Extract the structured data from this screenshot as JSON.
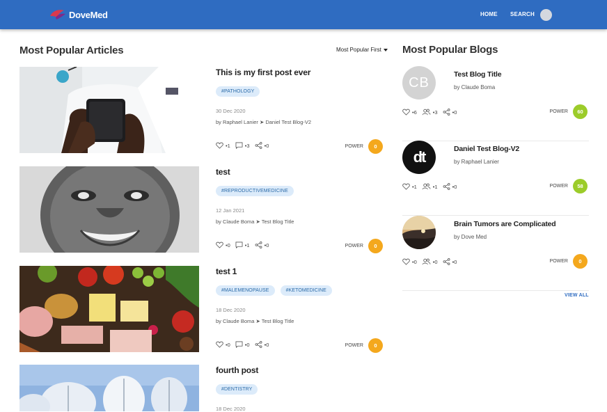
{
  "nav": {
    "logo": "DoveMed",
    "links": [
      "HOME",
      "SEARCH"
    ]
  },
  "articles_section": {
    "title": "Most Popular Articles",
    "sort_label": "Most Popular First",
    "items": [
      {
        "title": "This is my first post ever",
        "tags": [
          "#PATHOLOGY"
        ],
        "date": "30 Dec 2020",
        "byline": "by Raphael Lanier ➤ Daniel Test Blog-V2",
        "likes": "•1",
        "comments": "•3",
        "shares": "•0",
        "power_label": "POWER",
        "power": "0"
      },
      {
        "title": "test",
        "tags": [
          "#REPRODUCTIVEMEDICINE"
        ],
        "date": "12 Jan 2021",
        "byline": "by Claude Boma ➤ Test Blog Title",
        "likes": "•0",
        "comments": "•1",
        "shares": "•0",
        "power_label": "POWER",
        "power": "0"
      },
      {
        "title": "test 1",
        "tags": [
          "#MALEMENOPAUSE",
          "#KETOMEDICINE"
        ],
        "date": "18 Dec 2020",
        "byline": "by Claude Boma ➤ Test Blog Title",
        "likes": "•0",
        "comments": "•0",
        "shares": "•0",
        "power_label": "POWER",
        "power": "0"
      },
      {
        "title": "fourth post",
        "tags": [
          "#DENTISTRY"
        ],
        "date": "18 Dec 2020"
      }
    ]
  },
  "blogs_section": {
    "title": "Most Popular Blogs",
    "view_all": "VIEW ALL",
    "items": [
      {
        "avatar_text": "CB",
        "title": "Test Blog Title",
        "byline": "by Claude Boma",
        "likes": "•6",
        "followers": "•3",
        "shares": "•0",
        "power_label": "POWER",
        "power": "60"
      },
      {
        "avatar_text": "dt",
        "title": "Daniel Test Blog-V2",
        "byline": "by Raphael Lanier",
        "likes": "•1",
        "followers": "•1",
        "shares": "•0",
        "power_label": "POWER",
        "power": "58"
      },
      {
        "title": "Brain Tumors are Complicated",
        "byline": "by Dove Med",
        "likes": "•0",
        "followers": "•0",
        "shares": "•0",
        "power_label": "POWER",
        "power": "0"
      }
    ]
  },
  "colors": {
    "nav_blue": "#2f6cc1",
    "power_orange": "#f4a81d",
    "power_green": "#9ccc2a",
    "tag_bg": "#dcebfa"
  }
}
